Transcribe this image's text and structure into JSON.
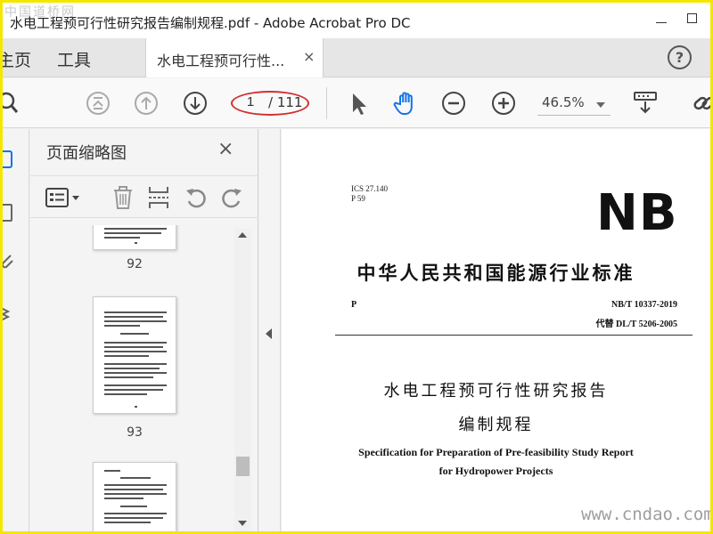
{
  "watermark_top": "中国道桥网",
  "watermark_bottom": "www.cndao.com",
  "window": {
    "title": "水电工程预可行性研究报告编制规程.pdf - Adobe Acrobat Pro DC"
  },
  "menubar": {
    "home_label": "主页",
    "tools_label": "工具",
    "doc_tab_label": "水电工程预可行性...",
    "doc_tab_close": "×",
    "help_label": "?"
  },
  "toolbar": {
    "page_current": "1",
    "page_total": "/ 111",
    "zoom": "46.5%",
    "icons": [
      "search-icon",
      "first-page-icon",
      "prev-page-icon",
      "next-page-icon",
      "select-cursor-icon",
      "hand-tool-icon",
      "zoom-out-icon",
      "zoom-in-icon",
      "scroll-mode-icon",
      "link-icon"
    ],
    "hand_tool_color": "#1473e6",
    "annotation_color": "#d32f2f"
  },
  "thumb_panel": {
    "title": "页面缩略图",
    "close": "×",
    "page_labels": [
      "92",
      "93"
    ]
  },
  "document": {
    "ics": "ICS 27.140",
    "p_code": "P 59",
    "nb_logo": "NB",
    "standard_title": "中华人民共和国能源行业标准",
    "p_mark": "P",
    "standard_number": "NB/T 10337-2019",
    "replaces": "代替 DL/T  5206-2005",
    "title_cn_line1": "水电工程预可行性研究报告",
    "title_cn_line2": "编制规程",
    "title_en_line1": "Specification for Preparation of Pre-feasibility Study Report",
    "title_en_line2": "for Hydropower Projects"
  }
}
